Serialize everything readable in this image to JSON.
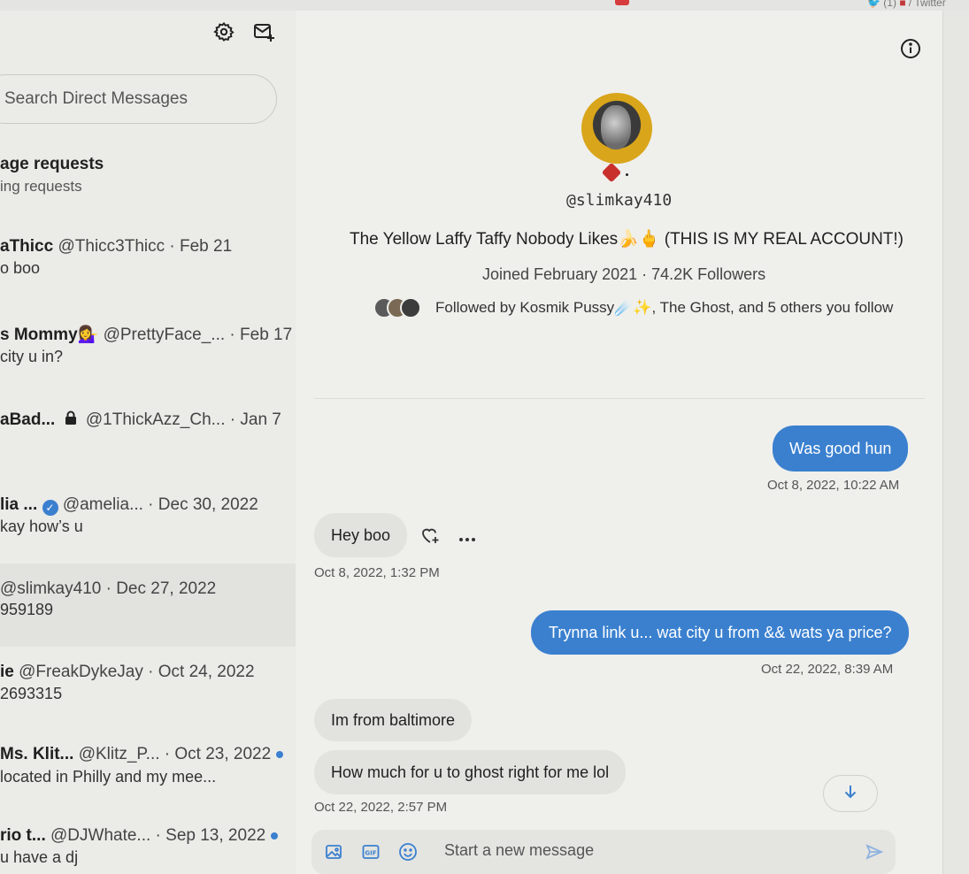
{
  "browser": {
    "tab_text_prefix": "(1)",
    "tab_title": "/ Twitter"
  },
  "sidebar": {
    "search_placeholder": "Search Direct Messages",
    "requests_title": "age requests",
    "requests_sub": "ing requests",
    "conversations": [
      {
        "name": "aThicc",
        "meta": "@Thicc3Thicc · Feb 21",
        "preview": "o boo",
        "unread": false
      },
      {
        "name": "s Mommy💁‍♀️",
        "meta": "@PrettyFace_... · Feb 17",
        "preview": "city u in?",
        "unread": false
      },
      {
        "name": "aBad...",
        "meta": "@1ThickAzz_Ch...  · Jan 7",
        "preview": "",
        "unread": false,
        "locked": true
      },
      {
        "name": "lia ...",
        "meta": "@amelia...   · Dec 30, 2022",
        "preview": "kay how’s u",
        "unread": false,
        "verified": true
      },
      {
        "name": "",
        "meta": "@slimkay410 · Dec 27, 2022",
        "preview": "959189",
        "unread": false,
        "active": true
      },
      {
        "name": "ie",
        "meta": "@FreakDykeJay · Oct 24, 2022",
        "preview": "2693315",
        "unread": false
      },
      {
        "name": "Ms. Klit...",
        "meta": "@Klitz_P... · Oct 23, 2022",
        "preview": "located in Philly and my mee...",
        "unread": true
      },
      {
        "name": "rio t...",
        "meta": "@DJWhate...  · Sep 13, 2022",
        "preview": "u have a dj",
        "unread": true
      }
    ]
  },
  "profile": {
    "handle": "@slimkay410",
    "bio": "The Yellow Laffy Taffy Nobody Likes🍌🖕 (THIS IS MY REAL ACCOUNT!)",
    "joined": "Joined February 2021 · 74.2K Followers",
    "followed_by": "Followed by Kosmik Pussy☄️✨, The Ghost, and 5 others you follow"
  },
  "messages": [
    {
      "direction": "out",
      "text": "Was good hun",
      "timestamp": "Oct 8, 2022, 10:22 AM"
    },
    {
      "direction": "in",
      "text": "Hey boo",
      "timestamp": "Oct 8, 2022, 1:32 PM"
    },
    {
      "direction": "out",
      "text": "Trynna link u... wat city u from && wats ya price?",
      "timestamp": "Oct 22, 2022, 8:39 AM"
    },
    {
      "direction": "in",
      "text": "Im from baltimore",
      "timestamp": ""
    },
    {
      "direction": "in",
      "text": "How much for u to ghost right for me lol",
      "timestamp": "Oct 22, 2022, 2:57 PM"
    }
  ],
  "composer": {
    "placeholder": "Start a new message"
  },
  "colors": {
    "accent": "#3a80cf",
    "bubble_in": "#e2e2df",
    "background": "#efefec"
  }
}
